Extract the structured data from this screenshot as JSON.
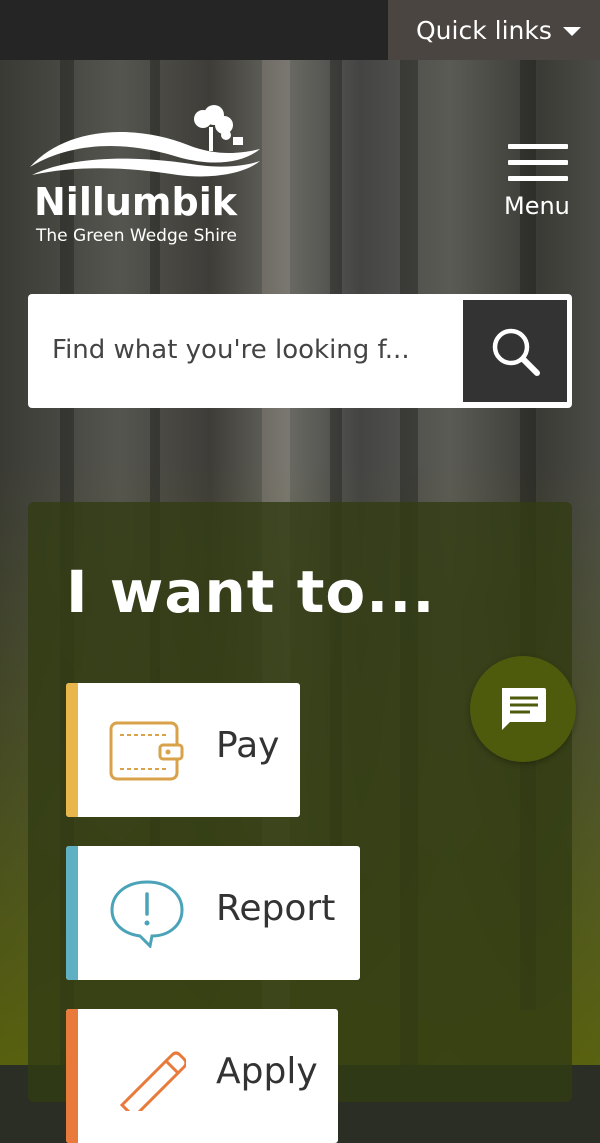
{
  "topbar": {
    "quick_links_label": "Quick links",
    "quick_links_icon": "caret-down-icon"
  },
  "brand": {
    "name": "Nillumbik",
    "tagline": "The Green Wedge Shire",
    "logo_icon": "hills-and-trees-logo"
  },
  "menu": {
    "label": "Menu",
    "icon": "hamburger-icon"
  },
  "search": {
    "placeholder": "Find what you're looking f...",
    "button_icon": "search-icon"
  },
  "i_want_to": {
    "title": "I want to...",
    "items": [
      {
        "label": "Pay",
        "icon": "wallet-icon",
        "accent": "#e8b64a"
      },
      {
        "label": "Report",
        "icon": "alert-speech-bubble-icon",
        "accent": "#5fb0c2"
      },
      {
        "label": "Apply",
        "icon": "pencil-icon",
        "accent": "#e87a3c"
      }
    ]
  },
  "chat": {
    "icon": "chat-bubble-icon",
    "color": "#4e5a0c"
  }
}
